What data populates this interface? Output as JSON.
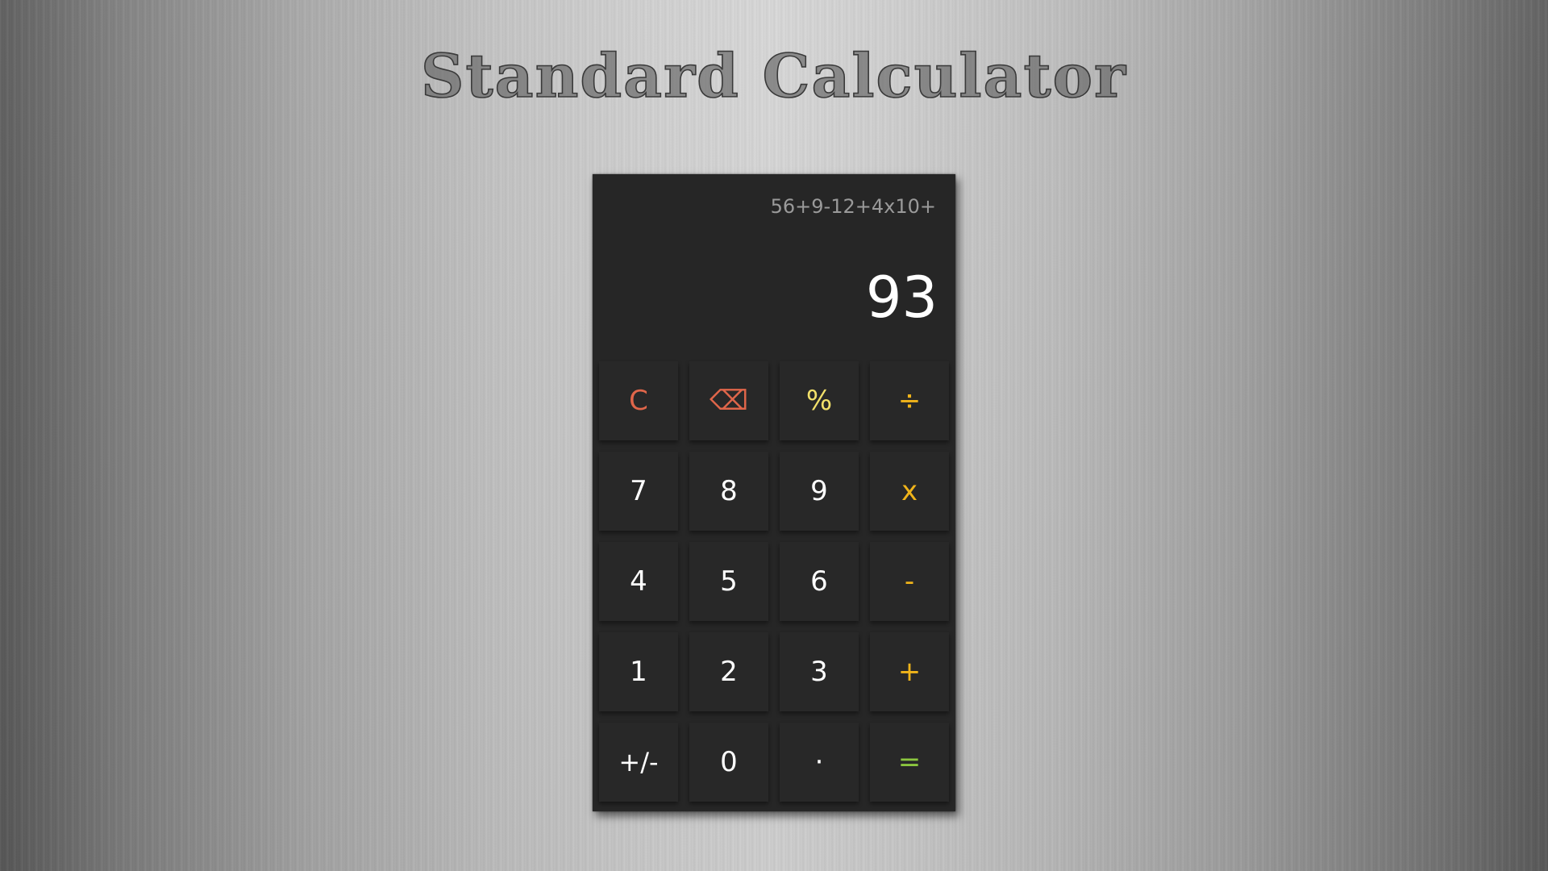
{
  "page": {
    "title": "Standard Calculator"
  },
  "display": {
    "expression": "56+9-12+4x10+",
    "result": "93"
  },
  "keys": {
    "clear": "C",
    "backspace": "⌫",
    "percent": "%",
    "divide": "÷",
    "seven": "7",
    "eight": "8",
    "nine": "9",
    "multiply": "x",
    "four": "4",
    "five": "5",
    "six": "6",
    "subtract": "-",
    "one": "1",
    "two": "2",
    "three": "3",
    "add": "+",
    "negate": "+/-",
    "zero": "0",
    "decimal": "·",
    "equals": "="
  },
  "colors": {
    "clear_backspace": "#e0664a",
    "percent": "#f2e06a",
    "operators": "#f0b41a",
    "equals": "#8cc63f",
    "calculator_body": "#262626"
  }
}
